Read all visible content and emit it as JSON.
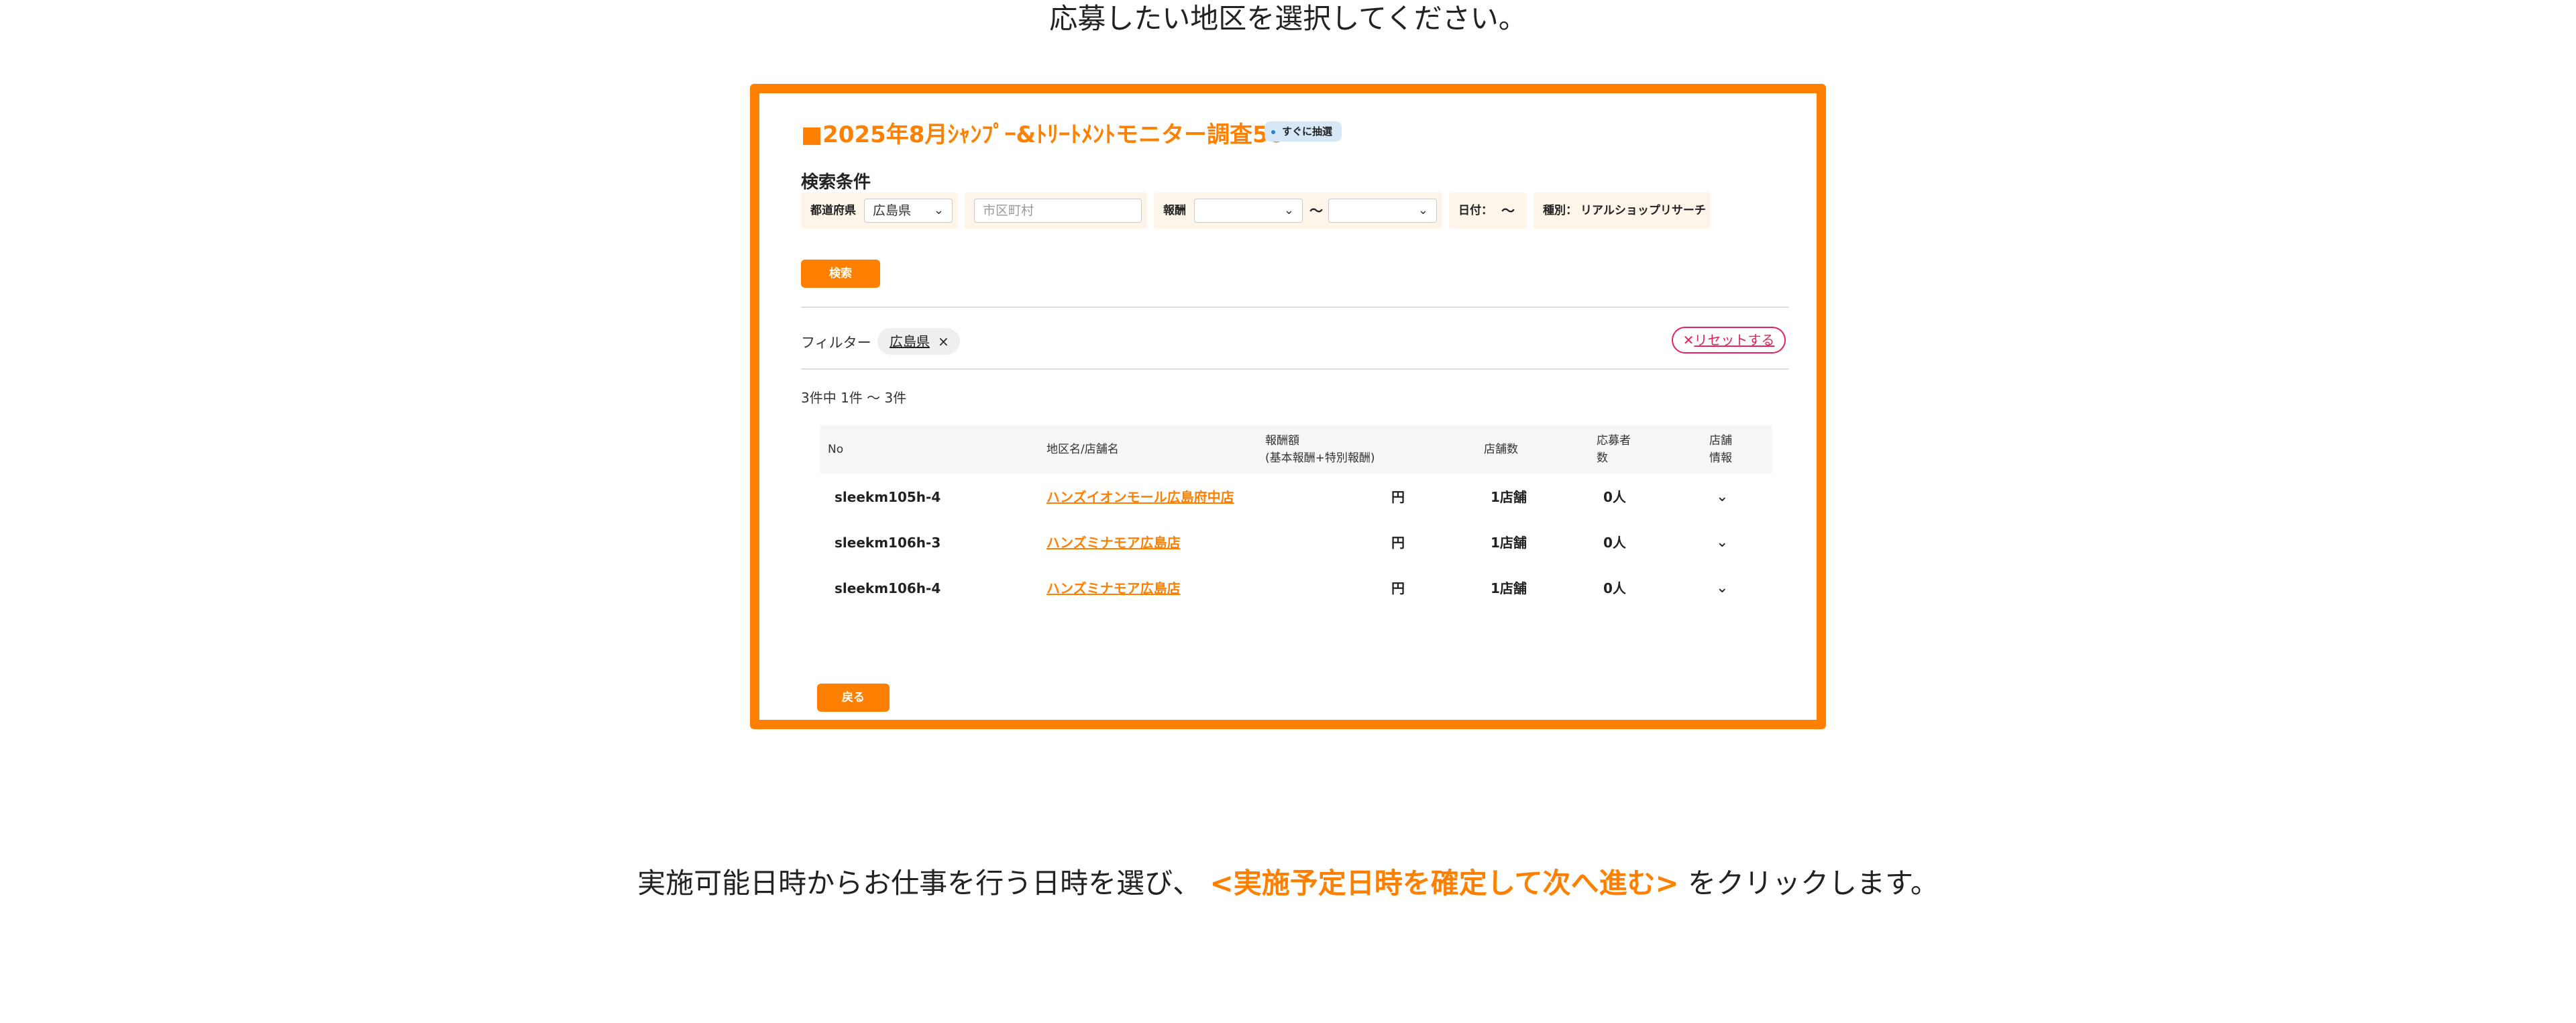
{
  "captions": {
    "top": "応募したい地区を選択してください。",
    "bottom_pre": "実施可能日時からお仕事を行う日時を選び、",
    "bottom_highlight": "<実施予定日時を確定して次へ進む>",
    "bottom_post": "をクリックします。"
  },
  "panel": {
    "title": "■2025年8月ｼｬﾝﾌﾟｰ&ﾄﾘｰﾄﾒﾝﾄモニター調査50",
    "badge": "すぐに抽選",
    "section_label": "検索条件"
  },
  "search": {
    "prefecture_label": "都道府県",
    "prefecture_value": "広島県",
    "city_placeholder": "市区町村",
    "reward_label": "報酬",
    "reward_from": "",
    "reward_separator": "〜",
    "reward_to": "",
    "date_label": "日付：",
    "date_separator": "〜",
    "type_label": "種別：",
    "type_value": "リアルショップリサーチ",
    "search_button": "検索"
  },
  "filter": {
    "label": "フィルター",
    "chip": "広島県",
    "chip_remove": "×",
    "reset_icon": "✕",
    "reset_label": "リセットする"
  },
  "results": {
    "count_text": "3件中 1件 〜 3件",
    "headers": {
      "no": "No",
      "area": "地区名/店舗名",
      "reward_line1": "報酬額",
      "reward_line2": "(基本報酬+特別報酬)",
      "stores": "店舗数",
      "applicants_line1": "応募者",
      "applicants_line2": "数",
      "info_line1": "店舗",
      "info_line2": "情報"
    },
    "rows": [
      {
        "no": "sleekm105h-4",
        "store": "ハンズイオンモール広島府中店",
        "reward": "円",
        "stores": "1店舗",
        "applicants": "0人"
      },
      {
        "no": "sleekm106h-3",
        "store": "ハンズミナモア広島店",
        "reward": "円",
        "stores": "1店舗",
        "applicants": "0人"
      },
      {
        "no": "sleekm106h-4",
        "store": "ハンズミナモア広島店",
        "reward": "円",
        "stores": "1店舗",
        "applicants": "0人"
      }
    ]
  },
  "back_button": "戻る",
  "colors": {
    "accent": "#FF8000",
    "reset": "#E0245E",
    "badge_bg": "#D6E8F7"
  }
}
